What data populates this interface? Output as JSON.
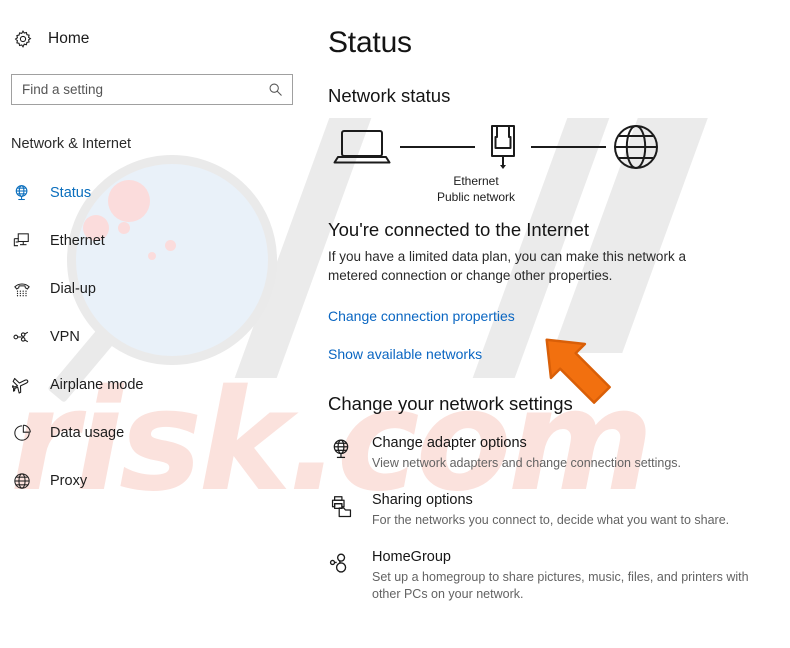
{
  "sidebar": {
    "home": {
      "label": "Home",
      "icon": "gear-icon"
    },
    "search": {
      "placeholder": "Find a setting",
      "value": "",
      "icon": "search-icon"
    },
    "section_title": "Network & Internet",
    "accent_color": "#0a6ebd",
    "items": [
      {
        "label": "Status",
        "icon": "globe-monitor-icon",
        "active": true
      },
      {
        "label": "Ethernet",
        "icon": "ethernet-monitor-icon",
        "active": false
      },
      {
        "label": "Dial-up",
        "icon": "phone-handset-icon",
        "active": false
      },
      {
        "label": "VPN",
        "icon": "vpn-key-icon",
        "active": false
      },
      {
        "label": "Airplane mode",
        "icon": "airplane-icon",
        "active": false
      },
      {
        "label": "Data usage",
        "icon": "pie-chart-icon",
        "active": false
      },
      {
        "label": "Proxy",
        "icon": "globe-icon",
        "active": false
      }
    ]
  },
  "main": {
    "page_title": "Status",
    "network_status_heading": "Network status",
    "diagram": {
      "nodes": [
        "laptop-icon",
        "ethernet-port-icon",
        "globe-icon"
      ],
      "caption_line1": "Ethernet",
      "caption_line2": "Public network"
    },
    "connection": {
      "heading": "You're connected to the Internet",
      "description": "If you have a limited data plan, you can make this network a metered connection or change other properties.",
      "links": [
        {
          "label": "Change connection properties"
        },
        {
          "label": "Show available networks"
        }
      ],
      "link_color": "#0a66c2"
    },
    "settings": {
      "heading": "Change your network settings",
      "items": [
        {
          "title": "Change adapter options",
          "description": "View network adapters and change connection settings.",
          "icon": "globe-monitor-icon"
        },
        {
          "title": "Sharing options",
          "description": "For the networks you connect to, decide what you want to share.",
          "icon": "printer-folder-icon"
        },
        {
          "title": "HomeGroup",
          "description": "Set up a homegroup to share pictures, music, files, and printers with other PCs on your network.",
          "icon": "homegroup-icon"
        }
      ]
    }
  },
  "overlay": {
    "cursor": {
      "icon": "orange-arrow-cursor",
      "color": "#f2700f"
    },
    "watermark": {
      "text": "risk.com",
      "icon": "magnifier-icon",
      "color": "#fbe2dd"
    }
  }
}
